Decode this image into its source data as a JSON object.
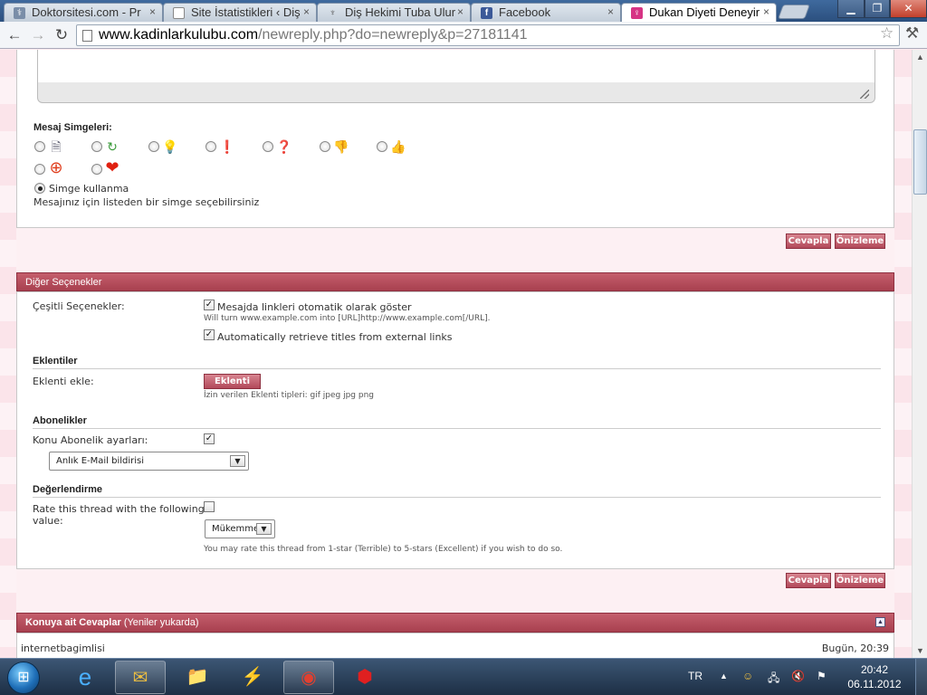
{
  "browser": {
    "tabs": [
      {
        "title": "Doktorsitesi.com - Pr",
        "icon": "doktor-favicon",
        "active": false
      },
      {
        "title": "Site İstatistikleri ‹ Diş",
        "icon": "page-favicon",
        "active": false
      },
      {
        "title": "Diş Hekimi Tuba Ulur",
        "icon": "tooth-favicon",
        "active": false
      },
      {
        "title": "Facebook",
        "icon": "facebook-favicon",
        "active": false
      },
      {
        "title": "Dukan Diyeti Deneyir",
        "icon": "kadinlar-favicon",
        "active": true
      }
    ],
    "url_host": "www.kadinlarkulubu.com",
    "url_path": "/newreply.php?do=newreply&p=27181141"
  },
  "post_icons": {
    "heading": "Mesaj Simgeleri:",
    "icons": [
      "note-icon",
      "arrow-icon",
      "lightbulb-icon",
      "exclamation-icon",
      "question-icon",
      "thumbs-down-icon",
      "thumbs-up-icon",
      "lifebuoy-icon",
      "heart-icon"
    ],
    "no_icon_label": "Simge kullanma",
    "hint": "Mesajınız için listeden bir simge seçebilirsiniz"
  },
  "buttons": {
    "reply": "Cevapla",
    "preview": "Önizleme"
  },
  "other_options": {
    "header": "Diğer Seçenekler",
    "misc_label": "Çeşitli Seçenekler:",
    "auto_links_label": "Mesajda linkleri otomatik olarak göster",
    "auto_links_hint": "Will turn www.example.com into [URL]http://www.example.com[/URL].",
    "auto_links_checked": true,
    "retrieve_titles_label": "Automatically retrieve titles from external links",
    "retrieve_titles_checked": true,
    "attachments_heading": "Eklentiler",
    "add_attachment_label": "Eklenti ekle:",
    "add_attachment_button": "Eklenti ekle",
    "allowed_types": "İzin verilen Eklenti tipleri: gif jpeg jpg png",
    "subscriptions_heading": "Abonelikler",
    "subscription_label": "Konu Abonelik ayarları:",
    "subscription_checked": true,
    "subscription_select": "Anlık E-Mail bildirisi",
    "rating_heading": "Değerlendirme",
    "rating_label_line1": "Rate this thread with the following",
    "rating_label_line2": "value:",
    "rating_checked": false,
    "rating_select": "Mükemmel",
    "rating_hint": "You may rate this thread from 1-star (Terrible) to 5-stars (Excellent) if you wish to do so."
  },
  "replies": {
    "header_bold": "Konuya ait Cevaplar",
    "header_rest": " (Yeniler yukarda)",
    "first_user": "internetbagimlisi",
    "first_time": "Bugün, 20:39"
  },
  "taskbar": {
    "language": "TR",
    "time": "20:42",
    "date": "06.11.2012"
  },
  "colors": {
    "accent": "#b2495a",
    "header": "#a8404f",
    "page_bg": "#fdf0f3"
  }
}
